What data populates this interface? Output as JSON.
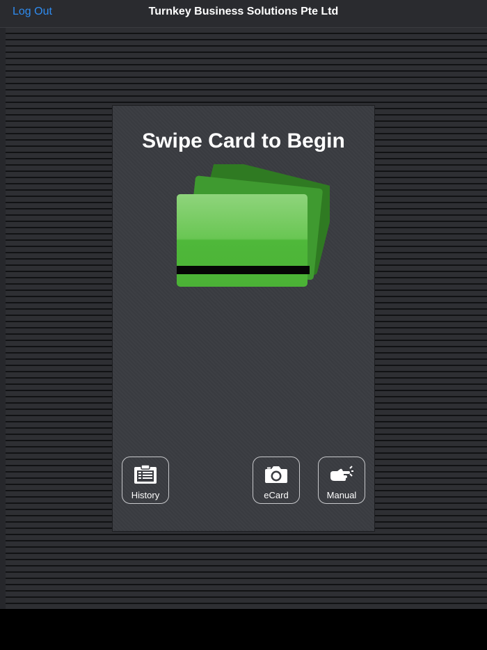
{
  "navbar": {
    "logout_label": "Log Out",
    "title": "Turnkey Business Solutions Pte Ltd"
  },
  "panel": {
    "title": "Swipe Card to Begin",
    "card_icon": "credit-cards-illustration"
  },
  "actions": [
    {
      "label": "History",
      "icon": "clipboard-icon"
    },
    {
      "label": "eCard",
      "icon": "camera-icon"
    },
    {
      "label": "Manual",
      "icon": "pointing-hand-icon"
    }
  ],
  "colors": {
    "link": "#2f8cf0",
    "card_green": "#4fb83a",
    "card_green_dark": "#2e7d22",
    "nav_background": "#2a2b2f",
    "panel_background": "#3a3c41"
  }
}
